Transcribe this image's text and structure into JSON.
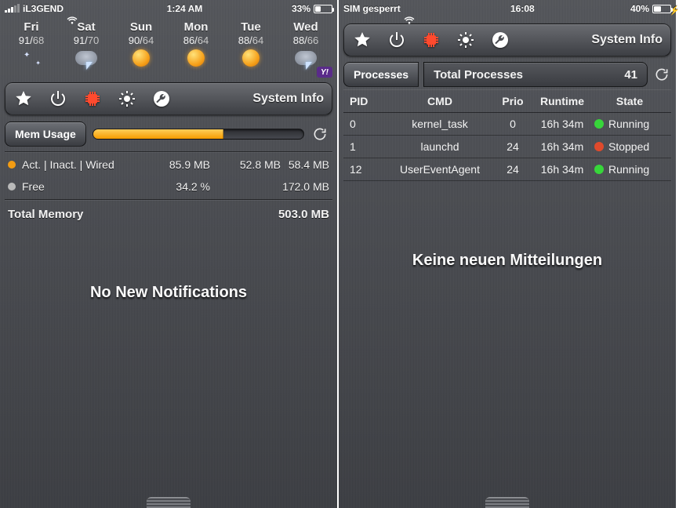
{
  "left": {
    "status": {
      "carrier": "iL3GEND",
      "time": "1:24 AM",
      "battery_pct": "33%",
      "battery_fill": 33,
      "charging": false
    },
    "weather": [
      {
        "day": "Fri",
        "hi": "91",
        "lo": "68",
        "icon": "stars"
      },
      {
        "day": "Sat",
        "hi": "91",
        "lo": "70",
        "icon": "storm"
      },
      {
        "day": "Sun",
        "hi": "90",
        "lo": "64",
        "icon": "sun"
      },
      {
        "day": "Mon",
        "hi": "86",
        "lo": "64",
        "icon": "sun"
      },
      {
        "day": "Tue",
        "hi": "88",
        "lo": "64",
        "icon": "sun"
      },
      {
        "day": "Wed",
        "hi": "88",
        "lo": "66",
        "icon": "storm"
      }
    ],
    "yahoo_badge": "Y!",
    "toolbar_title": "System Info",
    "mem": {
      "btn": "Mem Usage",
      "progress_pct": 62,
      "legend": "Act. | Inact. | Wired",
      "active": "85.9 MB",
      "inactive": "52.8 MB",
      "wired": "58.4 MB",
      "free_label": "Free",
      "free_pct": "34.2 %",
      "free_val": "172.0 MB",
      "total_label": "Total Memory",
      "total_val": "503.0 MB"
    },
    "no_notifications": "No New Notifications"
  },
  "right": {
    "status": {
      "carrier": "SIM gesperrt",
      "time": "16:08",
      "battery_pct": "40%",
      "battery_fill": 40,
      "charging": true
    },
    "toolbar_title": "System Info",
    "proc_header": {
      "tab": "Processes",
      "label": "Total Processes",
      "count": "41"
    },
    "columns": {
      "pid": "PID",
      "cmd": "CMD",
      "prio": "Prio",
      "runtime": "Runtime",
      "state": "State"
    },
    "rows": [
      {
        "pid": "0",
        "cmd": "kernel_task",
        "prio": "0",
        "runtime": "16h 34m",
        "state": "Running",
        "dot": "run"
      },
      {
        "pid": "1",
        "cmd": "launchd",
        "prio": "24",
        "runtime": "16h 34m",
        "state": "Stopped",
        "dot": "stop"
      },
      {
        "pid": "12",
        "cmd": "UserEventAgent",
        "prio": "24",
        "runtime": "16h 34m",
        "state": "Running",
        "dot": "run"
      }
    ],
    "no_notifications": "Keine neuen Mitteilungen"
  }
}
